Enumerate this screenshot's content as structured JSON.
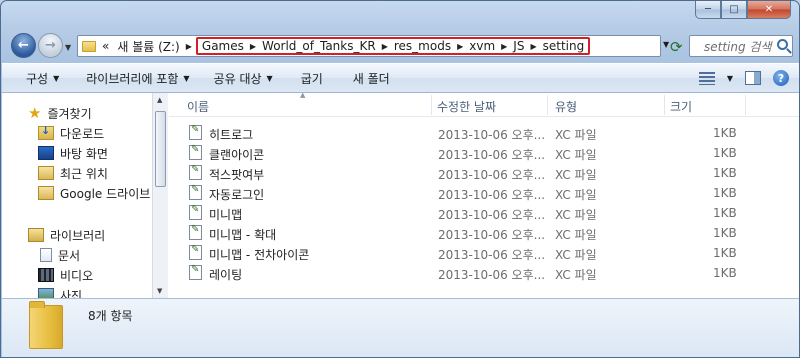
{
  "window": {
    "caption": {
      "minimize": "─",
      "maximize": "□",
      "close": "✕"
    }
  },
  "address_bar": {
    "lead": "«",
    "pre_crumbs": [
      "새 볼륨 (Z:)"
    ],
    "highlighted_crumbs": [
      "Games",
      "World_of_Tanks_KR",
      "res_mods",
      "xvm",
      "JS",
      "setting"
    ],
    "highlight_color": "#d0202a"
  },
  "search": {
    "placeholder": "setting 검색"
  },
  "toolbar": {
    "organize": "구성",
    "include_in_library": "라이브러리에 포함",
    "share_with": "공유 대상",
    "burn": "굽기",
    "new_folder": "새 폴더"
  },
  "nav": {
    "favorites": "즐겨찾기",
    "downloads": "다운로드",
    "desktop": "바탕 화면",
    "recent": "최근 위치",
    "google_drive": "Google 드라이브",
    "libraries": "라이브러리",
    "documents": "문서",
    "videos": "비디오",
    "pictures": "사진"
  },
  "columns": {
    "name": "이름",
    "modified": "수정한 날짜",
    "type": "유형",
    "size": "크기"
  },
  "files": [
    {
      "name": "히트로그",
      "modified": "2013-10-06 오후...",
      "type": "XC 파일",
      "size": "1KB"
    },
    {
      "name": "클랜아이콘",
      "modified": "2013-10-06 오후...",
      "type": "XC 파일",
      "size": "1KB"
    },
    {
      "name": "적스팟여부",
      "modified": "2013-10-06 오후...",
      "type": "XC 파일",
      "size": "1KB"
    },
    {
      "name": "자동로그인",
      "modified": "2013-10-06 오후...",
      "type": "XC 파일",
      "size": "1KB"
    },
    {
      "name": "미니맵",
      "modified": "2013-10-06 오후...",
      "type": "XC 파일",
      "size": "1KB"
    },
    {
      "name": "미니맵 - 확대",
      "modified": "2013-10-06 오후...",
      "type": "XC 파일",
      "size": "1KB"
    },
    {
      "name": "미니맵 - 전차아이콘",
      "modified": "2013-10-06 오후...",
      "type": "XC 파일",
      "size": "1KB"
    },
    {
      "name": "레이팅",
      "modified": "2013-10-06 오후...",
      "type": "XC 파일",
      "size": "1KB"
    }
  ],
  "details": {
    "count": "8개 항목"
  }
}
